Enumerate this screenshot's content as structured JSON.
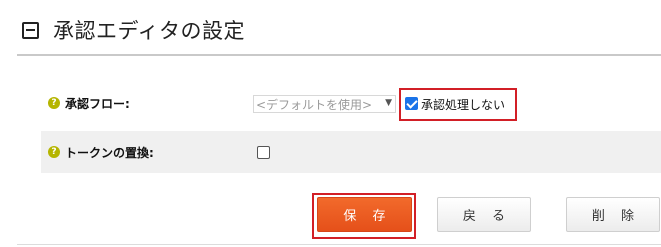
{
  "header": {
    "title": "承認エディタの設定"
  },
  "fields": {
    "approval_flow": {
      "label": "承認フロー:",
      "select_value": "<デフォルトを使用>",
      "checkbox_label": "承認処理しない",
      "checkbox_checked": true
    },
    "token_replace": {
      "label": "トークンの置換:",
      "checkbox_checked": false
    }
  },
  "icons": {
    "help": "?"
  },
  "buttons": {
    "save": "保 存",
    "back": "戻 る",
    "delete": "削 除"
  },
  "colors": {
    "accent": "#e85a1f",
    "highlight": "#d21f26",
    "help_icon": "#b5b500",
    "checkbox": "#1a73e8"
  }
}
